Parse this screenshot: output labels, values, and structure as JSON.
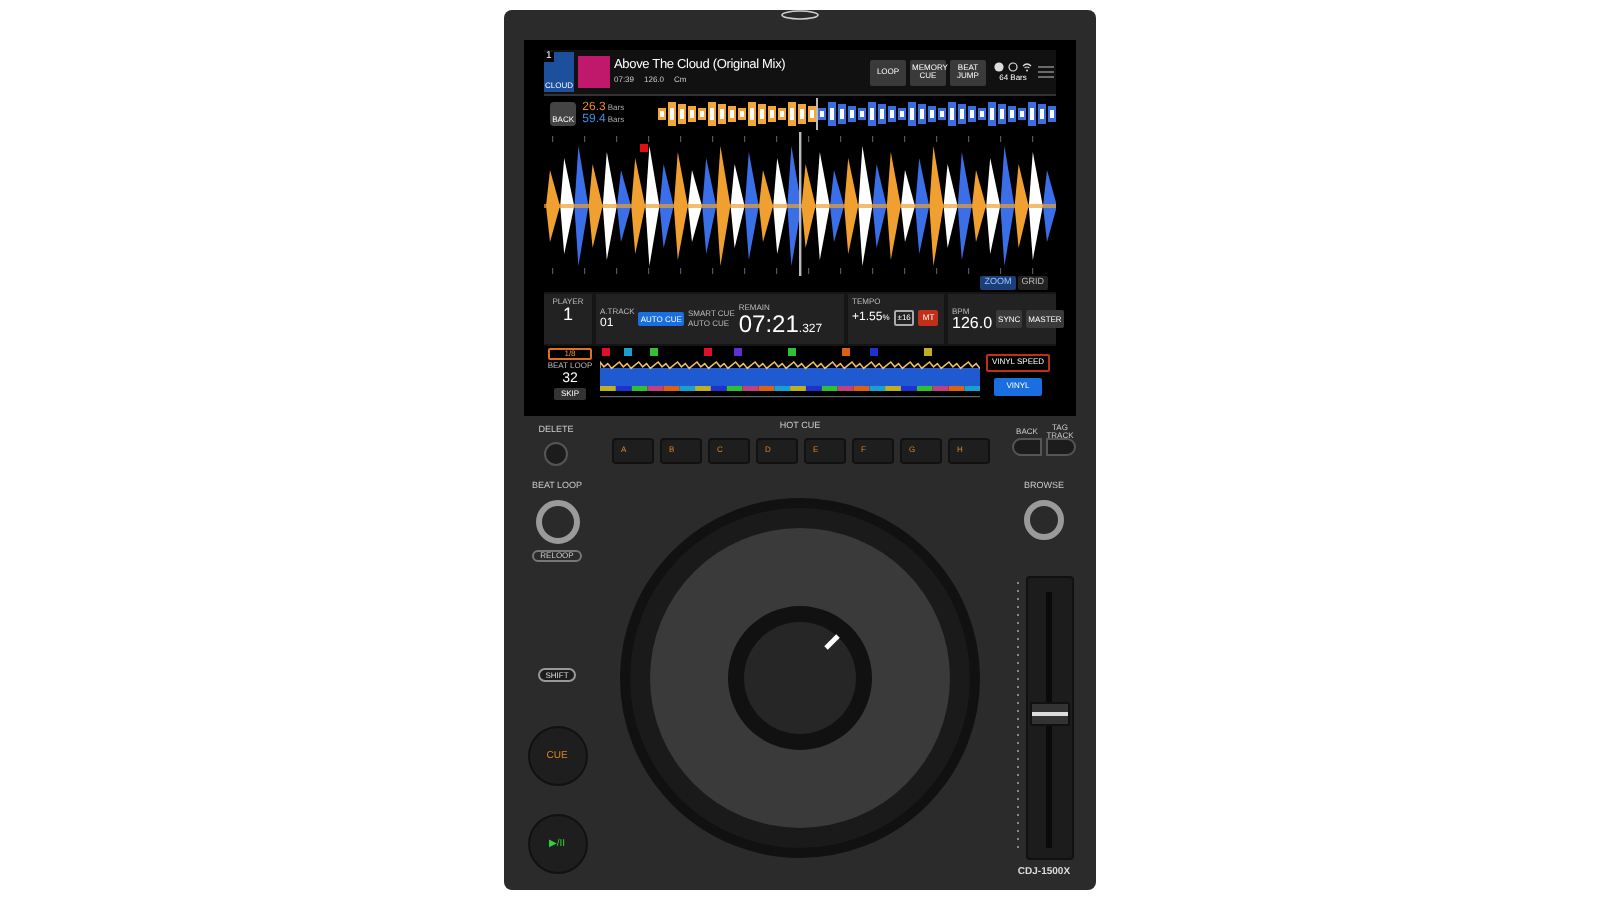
{
  "header": {
    "deck": "1",
    "source": "CLOUD",
    "title": "Above The Cloud (Original Mix)",
    "time": "07:39",
    "bpm": "126.0",
    "key": "Cm",
    "buttons": [
      "LOOP",
      "MEMORY CUE",
      "BEAT JUMP"
    ],
    "bars": "64 Bars"
  },
  "zoom_row": {
    "back": "BACK",
    "readings": [
      {
        "value": "26.3",
        "unit": "Bars",
        "color": "#f08a1c"
      },
      {
        "value": "59.4",
        "unit": "Bars",
        "color": "#3a8ee6"
      }
    ]
  },
  "waveform_controls": [
    {
      "label": "ZOOM",
      "selected": true
    },
    {
      "label": "GRID",
      "selected": false
    }
  ],
  "info": {
    "player_label": "PLAYER",
    "player": "1",
    "track_label": "A.TRACK",
    "track": "01",
    "auto_cue": "AUTO CUE",
    "smart_cue": "SMART CUE",
    "smart_cue_value": "AUTO CUE",
    "remain_label": "REMAIN",
    "remain": "07:21",
    "remain_ms": ".327",
    "tempo_label": "TEMPO",
    "tempo": "+1.55",
    "tempo_unit": "%",
    "range": "±16",
    "mt": "MT",
    "bpm_label": "BPM",
    "bpm": "126.0",
    "sync": "SYNC",
    "master": "MASTER"
  },
  "left_panel": {
    "loop_button": "1/8",
    "label": "BEAT LOOP",
    "value": "32",
    "skip": "SKIP"
  },
  "right_panel": {
    "top_button": "VINYL SPEED",
    "bottom_button": "VINYL"
  },
  "hot_cue_markers": [
    {
      "color": "#e0102a"
    },
    {
      "color": "#18a0d0"
    },
    {
      "color": "#30c030"
    },
    {
      "color": "#e0102a"
    },
    {
      "color": "#6030d0"
    },
    {
      "color": "#30c030"
    },
    {
      "color": "#e06010"
    },
    {
      "color": "#2030d0"
    },
    {
      "color": "#c0b020"
    }
  ],
  "deck": {
    "delete": "DELETE",
    "hot_cue": "HOT CUE",
    "pads": [
      "A",
      "B",
      "C",
      "D",
      "E",
      "F",
      "G",
      "H"
    ],
    "back": "BACK",
    "tag_track": "TAG TRACK",
    "beat_loop": "BEAT LOOP",
    "reloop": "RELOOP",
    "browse": "BROWSE",
    "shift": "SHIFT",
    "cue": "CUE",
    "play": "▶/II",
    "model": "CDJ-1500X"
  },
  "tempo_fader": {
    "level": 0.48
  }
}
